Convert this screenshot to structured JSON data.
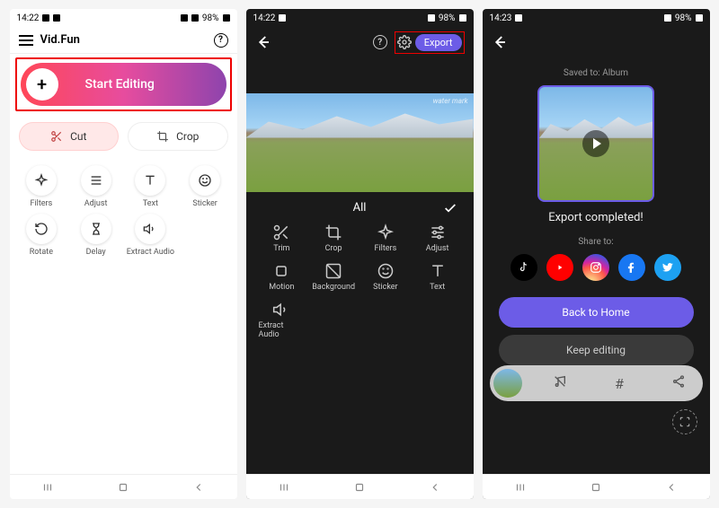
{
  "screen1": {
    "status": {
      "time": "14:22",
      "battery": "98%"
    },
    "app_title": "Vid.Fun",
    "start_label": "Start Editing",
    "cut_label": "Cut",
    "crop_label": "Crop",
    "tools": [
      {
        "label": "Filters"
      },
      {
        "label": "Adjust"
      },
      {
        "label": "Text"
      },
      {
        "label": "Sticker"
      },
      {
        "label": "Rotate"
      },
      {
        "label": "Delay"
      },
      {
        "label": "Extract Audio"
      }
    ]
  },
  "screen2": {
    "status": {
      "time": "14:22",
      "battery": "98%"
    },
    "export_label": "Export",
    "watermark": "water mark",
    "tab_label": "All",
    "tools": [
      {
        "label": "Trim"
      },
      {
        "label": "Crop"
      },
      {
        "label": "Filters"
      },
      {
        "label": "Adjust"
      },
      {
        "label": "Motion"
      },
      {
        "label": "Background"
      },
      {
        "label": "Sticker"
      },
      {
        "label": "Text"
      },
      {
        "label": "Extract Audio"
      }
    ]
  },
  "screen3": {
    "status": {
      "time": "14:23",
      "battery": "98%"
    },
    "saved_label": "Saved to: Album",
    "completed_label": "Export completed!",
    "share_label": "Share to:",
    "back_home_label": "Back to Home",
    "keep_editing_label": "Keep editing"
  },
  "colors": {
    "accent": "#6c5ce7",
    "highlight": "#e00000"
  }
}
